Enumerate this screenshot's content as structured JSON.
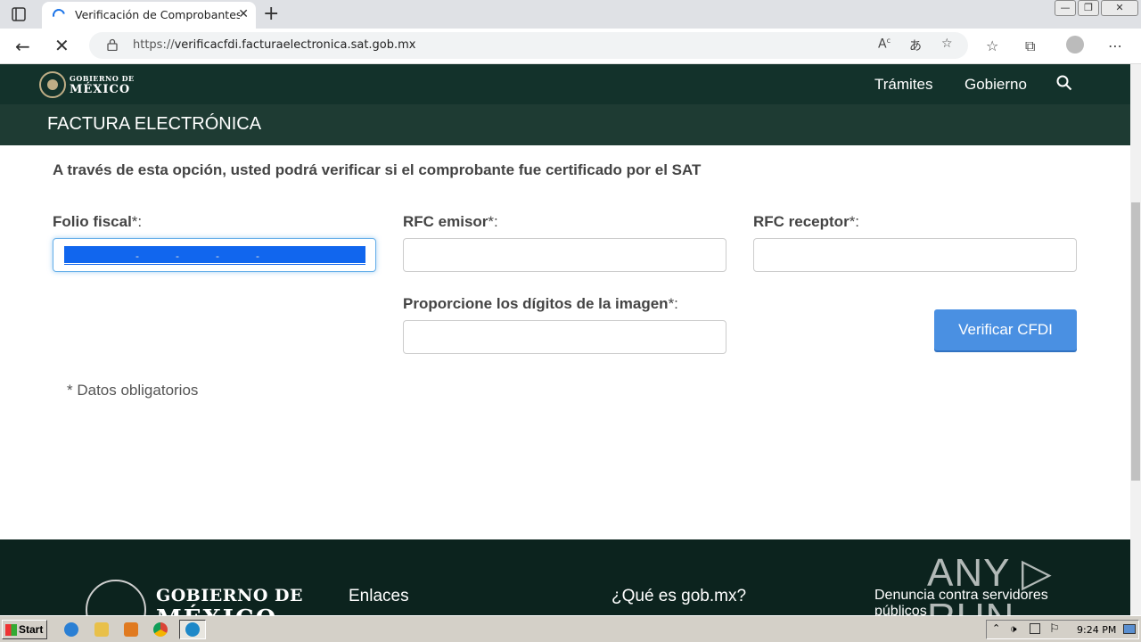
{
  "browser": {
    "tab_title": "Verificación de Comprobantes Fi",
    "tab_close": "✕",
    "new_tab": "+",
    "url_scheme": "https://",
    "url_host": "verificacfdi.facturaelectronica.sat.gob.mx",
    "window_controls": [
      "—",
      "❐",
      "✕"
    ]
  },
  "header": {
    "gov_line1": "GOBIERNO DE",
    "gov_line2": "MÉXICO",
    "nav": [
      "Trámites",
      "Gobierno"
    ],
    "section_title": "FACTURA ELECTRÓNICA"
  },
  "form": {
    "intro": "A través de esta opción, usted podrá verificar si el comprobante fue certificado por el SAT",
    "folio_label": "Folio fiscal",
    "rfc_emisor_label": "RFC emisor",
    "rfc_receptor_label": "RFC receptor",
    "captcha_label": "Proporcione los dígitos de la imagen",
    "required_mark": "*:",
    "folio_separators": [
      "-",
      "-",
      "-",
      "-"
    ],
    "verify_button": "Verificar CFDI",
    "required_note": "* Datos obligatorios"
  },
  "footer": {
    "gov_line1": "GOBIERNO DE",
    "gov_line2": "MÉXICO",
    "col1": "Enlaces",
    "col2": "¿Qué es gob.mx?",
    "col3": "Denuncia contra servidores públicos",
    "watermark": "ANY ▷ RUN"
  },
  "taskbar": {
    "start_label": "Start",
    "clock": "9:24 PM"
  },
  "colors": {
    "header_bg": "#13322b",
    "subheader_bg": "#1e3b33",
    "button_bg": "#4a90e2",
    "selection": "#1166ee"
  }
}
